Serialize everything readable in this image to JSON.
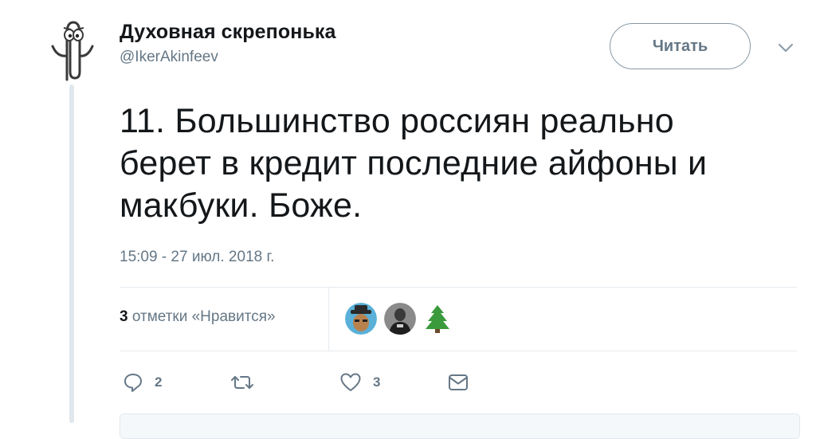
{
  "author": {
    "display_name": "Духовная скрепонька",
    "handle": "@IkerAkinfeev"
  },
  "follow_button_label": "Читать",
  "tweet": {
    "text": "11. Большинство россиян реально\nберет в кредит последние айфоны и\nмакбуки. Боже.",
    "timestamp": "15:09 - 27 июл. 2018 г."
  },
  "stats": {
    "likes_number": "3",
    "likes_label": " отметки «Нравится»",
    "liker_icons": [
      "avatar-hat-man",
      "avatar-dark-person",
      "christmas-tree-icon"
    ]
  },
  "actions": {
    "replies": "2",
    "retweets": "",
    "likes": "3"
  },
  "colors": {
    "text": "#14171a",
    "secondary": "#657786",
    "border": "#e6ecf0",
    "tree_green": "#3b9a3b"
  }
}
